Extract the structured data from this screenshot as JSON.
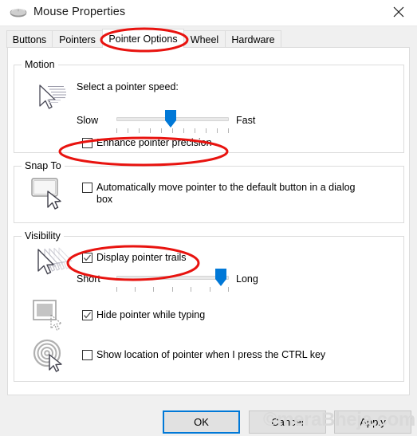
{
  "window": {
    "title": "Mouse Properties",
    "icon": "mouse-icon",
    "close_label": "×"
  },
  "tabs": [
    {
      "label": "Buttons",
      "selected": false
    },
    {
      "label": "Pointers",
      "selected": false
    },
    {
      "label": "Pointer Options",
      "selected": true
    },
    {
      "label": "Wheel",
      "selected": false
    },
    {
      "label": "Hardware",
      "selected": false
    }
  ],
  "groups": {
    "motion": {
      "title": "Motion",
      "speed_label": "Select a pointer speed:",
      "slow_label": "Slow",
      "fast_label": "Fast",
      "slider_value": 50,
      "slider_min": 0,
      "slider_max": 100,
      "tick_count": 11,
      "enhance_precision": {
        "label": "Enhance pointer precision",
        "checked": false,
        "annotated": true
      },
      "icon": "pointer-speed-icon"
    },
    "snap_to": {
      "title": "Snap To",
      "auto_move": {
        "label": "Automatically move pointer to the default button in a dialog box",
        "checked": false
      },
      "icon": "snap-to-button-icon"
    },
    "visibility": {
      "title": "Visibility",
      "display_trails": {
        "label": "Display pointer trails",
        "checked": true,
        "annotated": true
      },
      "short_label": "Short",
      "long_label": "Long",
      "trails_value": 93,
      "trails_min": 0,
      "trails_max": 100,
      "trails_tick_count": 7,
      "hide_while_typing": {
        "label": "Hide pointer while typing",
        "checked": true
      },
      "show_location": {
        "label": "Show location of pointer when I press the CTRL key",
        "checked": false
      },
      "icons": [
        "pointer-trails-icon",
        "hide-pointer-icon",
        "show-location-icon"
      ]
    }
  },
  "buttons": {
    "ok": "OK",
    "cancel": "Cancel",
    "apply": "Apply"
  },
  "watermark": "©meraBheja.com",
  "colors": {
    "accent": "#0078d7",
    "slider_thumb": "#0078d7",
    "annotation": "#e8130f",
    "dialog_bg": "#f0f0f0",
    "panel_bg": "#ffffff"
  }
}
